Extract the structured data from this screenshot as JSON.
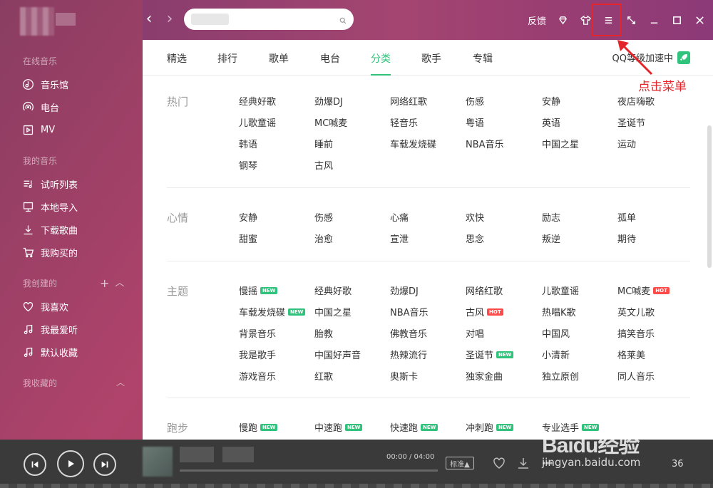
{
  "sidebar": {
    "online_section": "在线音乐",
    "online_items": [
      {
        "label": "音乐馆",
        "icon": "music-hall-icon"
      },
      {
        "label": "电台",
        "icon": "radio-icon"
      },
      {
        "label": "MV",
        "icon": "mv-icon"
      }
    ],
    "my_music_section": "我的音乐",
    "my_music_items": [
      {
        "label": "试听列表",
        "icon": "playlist-icon"
      },
      {
        "label": "本地导入",
        "icon": "monitor-icon"
      },
      {
        "label": "下载歌曲",
        "icon": "download-icon"
      },
      {
        "label": "我购买的",
        "icon": "cart-icon"
      }
    ],
    "created_section": "我创建的",
    "created_items": [
      {
        "label": "我喜欢",
        "icon": "heart-icon"
      },
      {
        "label": "我最爱听",
        "icon": "note-icon"
      },
      {
        "label": "默认收藏",
        "icon": "note-icon"
      }
    ],
    "collected_section": "我收藏的"
  },
  "header": {
    "back_icon": "chevron-left-icon",
    "forward_icon": "chevron-right-icon",
    "search_placeholder": "",
    "feedback_label": "反馈",
    "tools": [
      "diamond-icon",
      "skin-icon",
      "menu-icon",
      "mini-mode-icon",
      "minimize-icon",
      "maximize-icon",
      "close-icon"
    ]
  },
  "tabs": [
    {
      "label": "精选",
      "active": false
    },
    {
      "label": "排行",
      "active": false
    },
    {
      "label": "歌单",
      "active": false
    },
    {
      "label": "电台",
      "active": false
    },
    {
      "label": "分类",
      "active": true
    },
    {
      "label": "歌手",
      "active": false
    },
    {
      "label": "专辑",
      "active": false
    }
  ],
  "speed_up_label": "QQ等级加速中",
  "categories": [
    {
      "title": "热门",
      "items": [
        {
          "label": "经典好歌"
        },
        {
          "label": "劲爆DJ"
        },
        {
          "label": "网络红歌"
        },
        {
          "label": "伤感"
        },
        {
          "label": "安静"
        },
        {
          "label": "夜店嗨歌"
        },
        {
          "label": "儿歌童谣"
        },
        {
          "label": "MC喊麦"
        },
        {
          "label": "轻音乐"
        },
        {
          "label": "粤语"
        },
        {
          "label": "英语"
        },
        {
          "label": "圣诞节"
        },
        {
          "label": "韩语"
        },
        {
          "label": "睡前"
        },
        {
          "label": "车载发烧碟"
        },
        {
          "label": "NBA音乐"
        },
        {
          "label": "中国之星"
        },
        {
          "label": "运动"
        },
        {
          "label": "钢琴"
        },
        {
          "label": "古风"
        }
      ]
    },
    {
      "title": "心情",
      "items": [
        {
          "label": "安静"
        },
        {
          "label": "伤感"
        },
        {
          "label": "心痛"
        },
        {
          "label": "欢快"
        },
        {
          "label": "励志"
        },
        {
          "label": "孤单"
        },
        {
          "label": "甜蜜"
        },
        {
          "label": "治愈"
        },
        {
          "label": "宣泄"
        },
        {
          "label": "思念"
        },
        {
          "label": "叛逆"
        },
        {
          "label": "期待"
        }
      ]
    },
    {
      "title": "主题",
      "items": [
        {
          "label": "慢摇",
          "badge": "NEW"
        },
        {
          "label": "经典好歌"
        },
        {
          "label": "劲爆DJ"
        },
        {
          "label": "网络红歌"
        },
        {
          "label": "儿歌童谣"
        },
        {
          "label": "MC喊麦",
          "badge": "HOT"
        },
        {
          "label": "车载发烧碟",
          "badge": "NEW"
        },
        {
          "label": "中国之星"
        },
        {
          "label": "NBA音乐"
        },
        {
          "label": "古风",
          "badge": "HOT"
        },
        {
          "label": "热唱K歌"
        },
        {
          "label": "英文儿歌"
        },
        {
          "label": "背景音乐"
        },
        {
          "label": "胎教"
        },
        {
          "label": "佛教音乐"
        },
        {
          "label": "对唱"
        },
        {
          "label": "中国风"
        },
        {
          "label": "搞笑音乐"
        },
        {
          "label": "我是歌手"
        },
        {
          "label": "中国好声音"
        },
        {
          "label": "热辣流行"
        },
        {
          "label": "圣诞节",
          "badge": "NEW"
        },
        {
          "label": "小清新"
        },
        {
          "label": "格莱美"
        },
        {
          "label": "游戏音乐"
        },
        {
          "label": "红歌"
        },
        {
          "label": "奥斯卡"
        },
        {
          "label": "独家金曲"
        },
        {
          "label": "独立原创"
        },
        {
          "label": "同人音乐"
        }
      ]
    },
    {
      "title": "跑步",
      "items": [
        {
          "label": "慢跑",
          "badge": "NEW"
        },
        {
          "label": "中速跑",
          "badge": "NEW"
        },
        {
          "label": "快速跑",
          "badge": "NEW"
        },
        {
          "label": "冲刺跑",
          "badge": "NEW"
        },
        {
          "label": "专业选手",
          "badge": "NEW"
        }
      ]
    }
  ],
  "annotation": {
    "text": "点击菜单",
    "color": "#e3262b"
  },
  "player": {
    "time": "00:00 / 04:00",
    "quality": "标准▲",
    "count": "36"
  },
  "watermark": {
    "logo": "Baidu经验",
    "sub": "jingyan.baidu.com"
  },
  "colors": {
    "accent": "#31c27c",
    "hot": "#ff4a4a",
    "annotation": "#e3262b"
  }
}
